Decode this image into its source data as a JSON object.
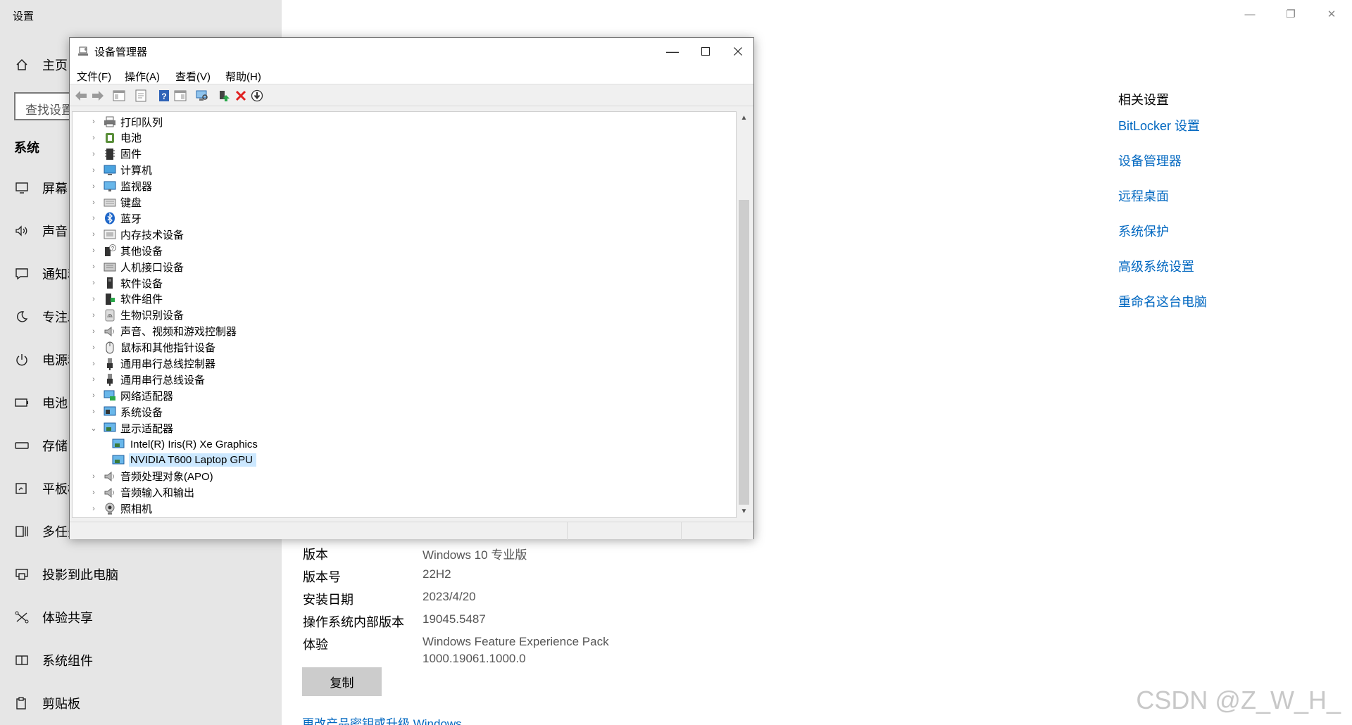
{
  "settings": {
    "window_title": "设置",
    "home_label": "主页",
    "search_placeholder": "查找设置",
    "section_heading": "系统",
    "nav_items": [
      {
        "label": "屏幕",
        "icon": "monitor-icon"
      },
      {
        "label": "声音",
        "icon": "speaker-icon"
      },
      {
        "label": "通知和操作",
        "icon": "notification-icon"
      },
      {
        "label": "专注助手",
        "icon": "moon-icon"
      },
      {
        "label": "电源和睡眠",
        "icon": "power-icon"
      },
      {
        "label": "电池",
        "icon": "battery-icon"
      },
      {
        "label": "存储",
        "icon": "storage-icon"
      },
      {
        "label": "平板模式",
        "icon": "tablet-icon"
      },
      {
        "label": "多任务处理",
        "icon": "multitask-icon"
      },
      {
        "label": "投影到此电脑",
        "icon": "project-icon"
      },
      {
        "label": "体验共享",
        "icon": "share-icon"
      },
      {
        "label": "系统组件",
        "icon": "components-icon"
      },
      {
        "label": "剪贴板",
        "icon": "clipboard-icon"
      }
    ],
    "window_controls": {
      "minimize": "—",
      "restore": "❐",
      "close": "✕"
    },
    "related": {
      "title": "相关设置",
      "links": [
        "BitLocker 设置",
        "设备管理器",
        "远程桌面",
        "系统保护",
        "高级系统设置",
        "重命名这台电脑"
      ]
    },
    "specs": [
      {
        "label": "版本",
        "value": "Windows 10 专业版"
      },
      {
        "label": "版本号",
        "value": "22H2"
      },
      {
        "label": "安装日期",
        "value": "2023/4/20"
      },
      {
        "label": "操作系统内部版本",
        "value": "19045.5487"
      },
      {
        "label": "体验",
        "value": "Windows Feature Experience Pack",
        "value2": "1000.19061.1000.0"
      }
    ],
    "copy_button": "复制",
    "upgrade_link": "更改产品密钥或升级 Windows",
    "watermark": "CSDN @Z_W_H_"
  },
  "device_manager": {
    "title": "设备管理器",
    "controls": {
      "minimize": "—",
      "maximize": "☐",
      "close": "✕"
    },
    "menus": [
      "文件(F)",
      "操作(A)",
      "查看(V)",
      "帮助(H)"
    ],
    "tree": [
      {
        "label": "打印队列",
        "icon": "printer-icon",
        "expanded": false
      },
      {
        "label": "电池",
        "icon": "battery-icon",
        "expanded": false
      },
      {
        "label": "固件",
        "icon": "firmware-icon",
        "expanded": false
      },
      {
        "label": "计算机",
        "icon": "computer-icon",
        "expanded": false
      },
      {
        "label": "监视器",
        "icon": "monitor-icon",
        "expanded": false
      },
      {
        "label": "键盘",
        "icon": "keyboard-icon",
        "expanded": false
      },
      {
        "label": "蓝牙",
        "icon": "bluetooth-icon",
        "expanded": false
      },
      {
        "label": "内存技术设备",
        "icon": "memory-icon",
        "expanded": false
      },
      {
        "label": "其他设备",
        "icon": "unknown-device-icon",
        "expanded": false
      },
      {
        "label": "人机接口设备",
        "icon": "hid-icon",
        "expanded": false
      },
      {
        "label": "软件设备",
        "icon": "software-device-icon",
        "expanded": false
      },
      {
        "label": "软件组件",
        "icon": "software-component-icon",
        "expanded": false
      },
      {
        "label": "生物识别设备",
        "icon": "fingerprint-icon",
        "expanded": false
      },
      {
        "label": "声音、视频和游戏控制器",
        "icon": "speaker-icon",
        "expanded": false
      },
      {
        "label": "鼠标和其他指针设备",
        "icon": "mouse-icon",
        "expanded": false
      },
      {
        "label": "通用串行总线控制器",
        "icon": "usb-icon",
        "expanded": false
      },
      {
        "label": "通用串行总线设备",
        "icon": "usb-icon",
        "expanded": false
      },
      {
        "label": "网络适配器",
        "icon": "network-icon",
        "expanded": false
      },
      {
        "label": "系统设备",
        "icon": "system-device-icon",
        "expanded": false
      },
      {
        "label": "显示适配器",
        "icon": "display-adapter-icon",
        "expanded": true,
        "children": [
          {
            "label": "Intel(R) Iris(R) Xe Graphics",
            "icon": "display-adapter-icon",
            "selected": false
          },
          {
            "label": "NVIDIA T600 Laptop GPU",
            "icon": "display-adapter-icon",
            "selected": true
          }
        ]
      },
      {
        "label": "音频处理对象(APO)",
        "icon": "speaker-icon",
        "expanded": false
      },
      {
        "label": "音频输入和输出",
        "icon": "speaker-icon",
        "expanded": false
      },
      {
        "label": "照相机",
        "icon": "camera-icon",
        "expanded": false
      }
    ]
  },
  "colors": {
    "link": "#0067c0",
    "selection": "#cce8ff",
    "sidebar": "#e6e6e6"
  }
}
